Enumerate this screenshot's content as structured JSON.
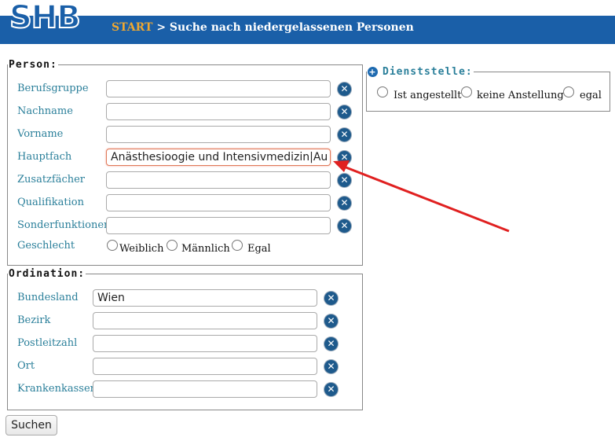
{
  "header": {
    "logo": "SHB",
    "start": "START",
    "separator": ">",
    "title": "Suche nach niedergelassenen Personen"
  },
  "person": {
    "legend": "Person:",
    "fields": [
      {
        "label": "Berufsgruppe",
        "value": ""
      },
      {
        "label": "Nachname",
        "value": ""
      },
      {
        "label": "Vorname",
        "value": ""
      },
      {
        "label": "Hauptfach",
        "value": "Anästhesioogie und Intensivmedizin|Au"
      },
      {
        "label": "Zusatzfächer",
        "value": ""
      },
      {
        "label": "Qualifikation",
        "value": ""
      },
      {
        "label": "Sonderfunktionen",
        "value": ""
      }
    ],
    "gender": {
      "label": "Geschlecht",
      "options": [
        "Weiblich",
        "Männlich",
        "Egal"
      ]
    }
  },
  "ordination": {
    "legend": "Ordination:",
    "fields": [
      {
        "label": "Bundesland",
        "value": "Wien"
      },
      {
        "label": "Bezirk",
        "value": ""
      },
      {
        "label": "Postleitzahl",
        "value": ""
      },
      {
        "label": "Ort",
        "value": ""
      },
      {
        "label": "Krankenkassen",
        "value": ""
      }
    ]
  },
  "dienststelle": {
    "legend": "Dienststelle:",
    "options": [
      "Ist angestellt",
      "keine Anstellung",
      "egal"
    ]
  },
  "search_button": "Suchen",
  "colors": {
    "header_bg": "#1a5fa8",
    "label": "#2a7f9a",
    "arrow": "#e02020",
    "start": "#f0a830"
  },
  "icons": [
    "clear-icon",
    "expand-plus-icon",
    "annotation-arrow"
  ]
}
